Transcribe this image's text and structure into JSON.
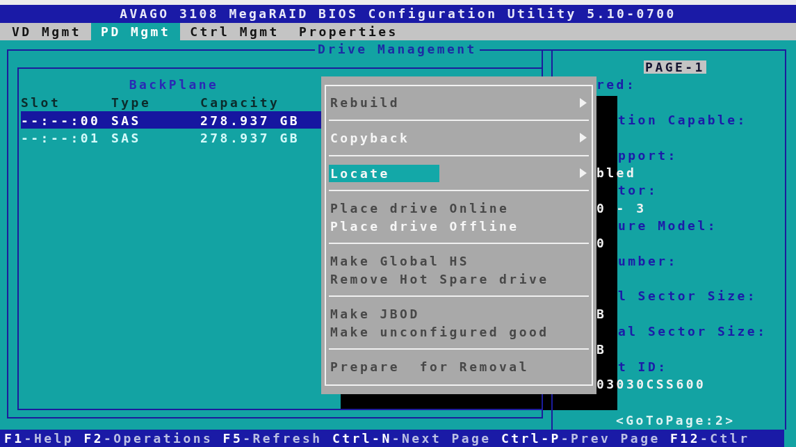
{
  "window": {
    "title": "AVAGO 3108 MegaRAID BIOS Configuration Utility 5.10-0700"
  },
  "menu_bar": [
    {
      "label": "VD Mgmt",
      "selected": false
    },
    {
      "label": "PD Mgmt",
      "selected": true
    },
    {
      "label": "Ctrl Mgmt",
      "selected": false
    },
    {
      "label": "Properties",
      "selected": false
    }
  ],
  "drive_management": {
    "title": "Drive Management",
    "drive_list": {
      "title": "BackPlane",
      "columns": [
        "Slot",
        "Type",
        "Capacity"
      ],
      "rows": [
        {
          "slot": "--:--:00",
          "type": "SAS",
          "capacity": "278.937 GB",
          "selected": true
        },
        {
          "slot": "--:--:01",
          "type": "SAS",
          "capacity": "278.937 GB",
          "selected": false
        }
      ]
    },
    "properties": {
      "page": "PAGE-1",
      "fields": [
        {
          "label": "red:"
        },
        {
          "label": "tion Capable:"
        },
        {
          "label": "pport:",
          "value": "bled"
        },
        {
          "label": "tor:",
          "value": "0 - 3"
        },
        {
          "label": "ure Model:",
          "value": "0"
        },
        {
          "label": "umber:"
        },
        {
          "label": "l Sector Size:",
          "value": "B"
        },
        {
          "label": "al Sector Size:",
          "value": "B"
        },
        {
          "label": "t ID:",
          "value": "03030CSS600"
        }
      ],
      "next_page": "<GoToPage:2>"
    }
  },
  "context_menu": {
    "groups": [
      [
        {
          "label": "Rebuild",
          "disabled": true,
          "submenu": true,
          "selected": false
        }
      ],
      [
        {
          "label": "Copyback",
          "disabled": false,
          "submenu": true,
          "selected": false
        }
      ],
      [
        {
          "label": "Locate",
          "disabled": false,
          "submenu": true,
          "selected": true
        }
      ],
      [
        {
          "label": "Place drive Online",
          "disabled": true,
          "submenu": false,
          "selected": false
        },
        {
          "label": "Place drive Offline",
          "disabled": false,
          "submenu": false,
          "selected": false
        }
      ],
      [
        {
          "label": "Make Global HS",
          "disabled": true,
          "submenu": false,
          "selected": false
        },
        {
          "label": "Remove Hot Spare drive",
          "disabled": true,
          "submenu": false,
          "selected": false
        }
      ],
      [
        {
          "label": "Make JBOD",
          "disabled": true,
          "submenu": false,
          "selected": false
        },
        {
          "label": "Make unconfigured good",
          "disabled": true,
          "submenu": false,
          "selected": false
        }
      ],
      [
        {
          "label": "Prepare  for Removal",
          "disabled": true,
          "submenu": false,
          "selected": false
        }
      ]
    ]
  },
  "status_bar": [
    {
      "key": "F1",
      "action": "-Help"
    },
    {
      "key": "F2",
      "action": "-Operations"
    },
    {
      "key": "F5",
      "action": "-Refresh"
    },
    {
      "key": "Ctrl-N",
      "action": "-Next Page"
    },
    {
      "key": "Ctrl-P",
      "action": "-Prev Page"
    },
    {
      "key": "F12",
      "action": "-Ctlr"
    }
  ]
}
